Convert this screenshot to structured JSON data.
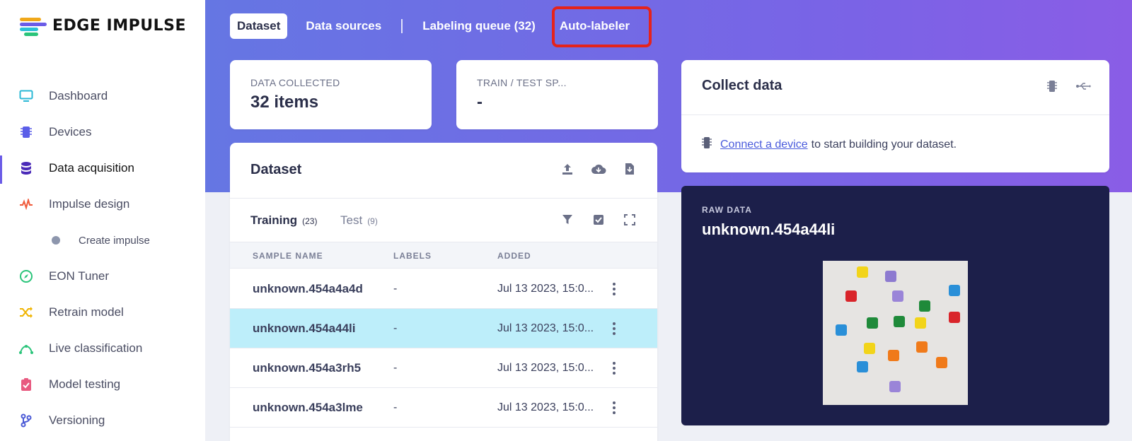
{
  "brand": {
    "name": "EDGE IMPULSE"
  },
  "sidebar": {
    "items": [
      {
        "label": "Dashboard",
        "icon": "monitor-icon",
        "color": "#2bb8d6"
      },
      {
        "label": "Devices",
        "icon": "chip-icon",
        "color": "#5b5ee8"
      },
      {
        "label": "Data acquisition",
        "icon": "database-icon",
        "color": "#4b2bb8",
        "active": true
      },
      {
        "label": "Impulse design",
        "icon": "pulse-icon",
        "color": "#f05a3a"
      },
      {
        "label": "Create impulse",
        "icon": "dot-icon",
        "color": "#8d96ad",
        "sub": true
      },
      {
        "label": "EON Tuner",
        "icon": "compass-icon",
        "color": "#2ac47a"
      },
      {
        "label": "Retrain model",
        "icon": "shuffle-icon",
        "color": "#f0b400"
      },
      {
        "label": "Live classification",
        "icon": "curve-icon",
        "color": "#2ac47a"
      },
      {
        "label": "Model testing",
        "icon": "clipboard-check-icon",
        "color": "#e85a80"
      },
      {
        "label": "Versioning",
        "icon": "branch-icon",
        "color": "#4b5ad6"
      }
    ]
  },
  "top_tabs": [
    {
      "label": "Dataset",
      "active": true
    },
    {
      "label": "Data sources"
    },
    {
      "label": "Labeling queue (32)"
    },
    {
      "label": "Auto-labeler",
      "highlighted": true
    }
  ],
  "stats": {
    "collected": {
      "label": "DATA COLLECTED",
      "value": "32 items"
    },
    "split": {
      "label": "TRAIN / TEST SP...",
      "value": "-"
    }
  },
  "dataset": {
    "title": "Dataset",
    "actions": [
      "upload-icon",
      "cloud-download-icon",
      "file-download-icon"
    ],
    "subtabs": [
      {
        "label": "Training",
        "count": "(23)",
        "active": true
      },
      {
        "label": "Test",
        "count": "(9)"
      }
    ],
    "tools": [
      "filter-icon",
      "select-all-icon",
      "expand-icon"
    ],
    "columns": [
      "SAMPLE NAME",
      "LABELS",
      "ADDED"
    ],
    "rows": [
      {
        "name": "unknown.454a4a4d",
        "labels": "-",
        "added": "Jul 13 2023, 15:0..."
      },
      {
        "name": "unknown.454a44li",
        "labels": "-",
        "added": "Jul 13 2023, 15:0...",
        "selected": true
      },
      {
        "name": "unknown.454a3rh5",
        "labels": "-",
        "added": "Jul 13 2023, 15:0..."
      },
      {
        "name": "unknown.454a3lme",
        "labels": "-",
        "added": "Jul 13 2023, 15:0..."
      }
    ]
  },
  "collect": {
    "title": "Collect data",
    "icons": [
      "device-icon",
      "usb-icon"
    ],
    "link": "Connect a device",
    "text": "to start building your dataset."
  },
  "raw": {
    "label": "RAW DATA",
    "name": "unknown.454a44li",
    "image_alt": "colorful dice on white surface"
  },
  "colors": {
    "accent": "#6b5ce7",
    "highlight_border": "#e5231b",
    "selected_row": "#bdeefa",
    "raw_panel": "#1c1f4a"
  }
}
